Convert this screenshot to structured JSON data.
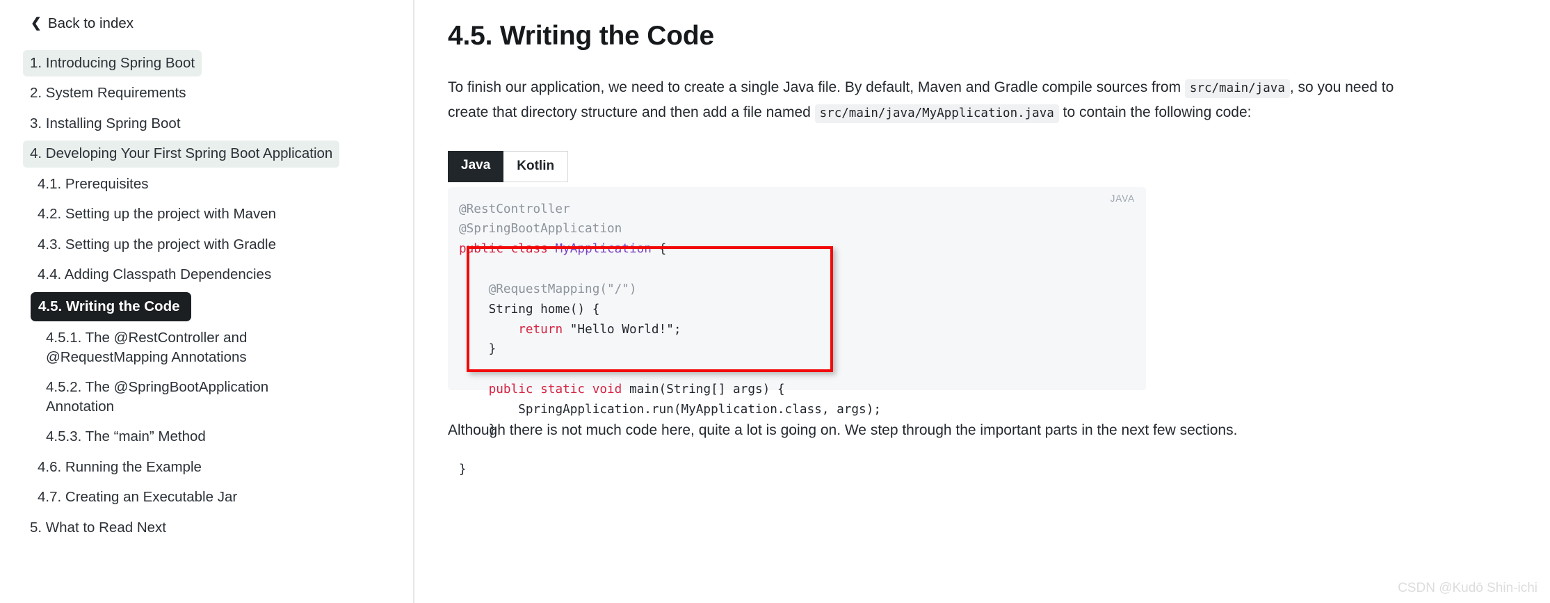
{
  "sidebar": {
    "back_link": {
      "label": "Back to index",
      "icon": "chevron-left-icon"
    },
    "items": [
      {
        "label": "1. Introducing Spring Boot",
        "level": 1,
        "state": "normal"
      },
      {
        "label": "2. System Requirements",
        "level": 1,
        "state": "normal"
      },
      {
        "label": "3. Installing Spring Boot",
        "level": 1,
        "state": "normal"
      },
      {
        "label": "4. Developing Your First Spring Boot Application",
        "level": 1,
        "state": "open"
      },
      {
        "label": "4.1. Prerequisites",
        "level": 2,
        "state": "normal"
      },
      {
        "label": "4.2. Setting up the project with Maven",
        "level": 2,
        "state": "normal"
      },
      {
        "label": "4.3. Setting up the project with Gradle",
        "level": 2,
        "state": "normal"
      },
      {
        "label": "4.4. Adding Classpath Dependencies",
        "level": 2,
        "state": "normal"
      },
      {
        "label": "4.5. Writing the Code",
        "level": 2,
        "state": "active"
      },
      {
        "label": "4.5.1. The @RestController and @RequestMapping Annotations",
        "level": 3,
        "state": "normal"
      },
      {
        "label": "4.5.2. The @SpringBootApplication Annotation",
        "level": 3,
        "state": "normal"
      },
      {
        "label": "4.5.3. The “main” Method",
        "level": 3,
        "state": "normal"
      },
      {
        "label": "4.6. Running the Example",
        "level": 2,
        "state": "normal"
      },
      {
        "label": "4.7. Creating an Executable Jar",
        "level": 2,
        "state": "normal"
      },
      {
        "label": "5. What to Read Next",
        "level": 1,
        "state": "normal"
      }
    ]
  },
  "main": {
    "title": "4.5. Writing the Code",
    "intro": {
      "part1": "To finish our application, we need to create a single Java file. By default, Maven and Gradle compile sources from ",
      "code1": "src/main/java",
      "part2": ", so you need to create that directory structure and then add a file named ",
      "code2": "src/main/java/MyApplication.java",
      "part3": " to contain the following code:"
    },
    "tabs": [
      {
        "label": "Java",
        "selected": true
      },
      {
        "label": "Kotlin",
        "selected": false
      }
    ],
    "code_block": {
      "language_label": "JAVA",
      "lines": [
        "@RestController",
        "@SpringBootApplication",
        "public class MyApplication {",
        "",
        "    @RequestMapping(\"/\")",
        "    String home() {",
        "        return \"Hello World!\";",
        "    }",
        "",
        "    public static void main(String[] args) {",
        "        SpringApplication.run(MyApplication.class, args);",
        "    }",
        "",
        "}"
      ]
    },
    "annotation": {
      "shape": "rectangle",
      "color": "#f20808"
    },
    "outro": "Although there is not much code here, quite a lot is going on. We step through the important parts in the next few sections."
  },
  "watermark": "CSDN @Kudō Shin-ichi",
  "colors": {
    "active_item_bg": "#1c1f22",
    "open_item_bg": "#e9efec",
    "code_bg": "#f6f7f9",
    "inline_code_bg": "#f0f1f2",
    "keyword": "#d62341",
    "type": "#7b43c1",
    "annotation_token": "#8d949c",
    "annotation_box": "#f20808"
  }
}
